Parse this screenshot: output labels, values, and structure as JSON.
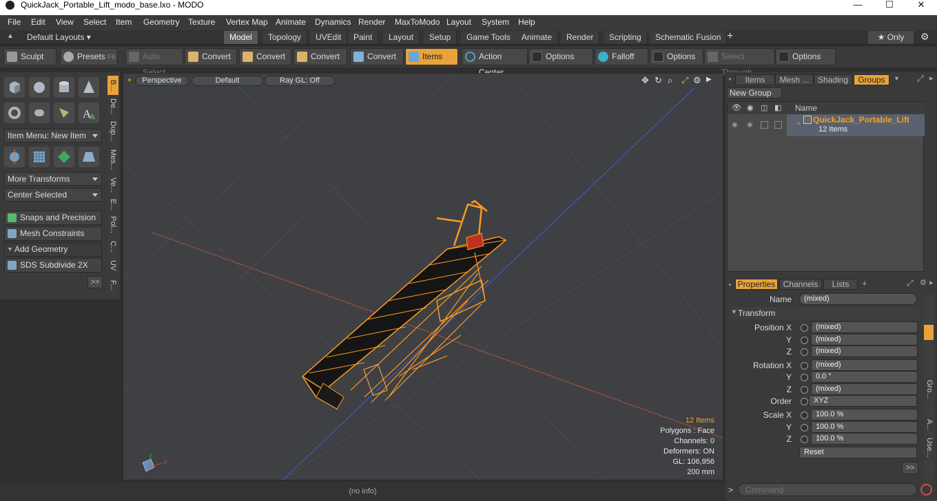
{
  "window": {
    "title": "QuickJack_Portable_Lift_modo_base.lxo - MODO",
    "minimize": "—",
    "maximize": "☐",
    "close": "✕"
  },
  "menu": [
    "File",
    "Edit",
    "View",
    "Select",
    "Item",
    "Geometry",
    "Texture",
    "Vertex Map",
    "Animate",
    "Dynamics",
    "Render",
    "MaxToModo",
    "Layout",
    "System",
    "Help"
  ],
  "layouts": {
    "selector": "Default Layouts ▾",
    "tabs": [
      "Model",
      "Topology",
      "UVEdit",
      "Paint",
      "Layout",
      "Setup",
      "Game Tools",
      "Animate",
      "Render",
      "Scripting",
      "Schematic Fusion"
    ],
    "add": "+",
    "only": "★ Only",
    "gear": "⚙"
  },
  "toolbar": {
    "sculpt": "Sculpt",
    "presets": "Presets",
    "presets_key": "F6",
    "auto_select": "Auto Select",
    "convert": "Convert",
    "items": "Items",
    "action_center": "Action Center",
    "options": "Options",
    "falloff": "Falloff",
    "select_through": "Select Through"
  },
  "left": {
    "item_menu": "Item Menu: New Item",
    "more_transforms": "More Transforms",
    "center_selected": "Center Selected",
    "snaps": "Snaps and Precision",
    "mesh_constraints": "Mesh Constraints",
    "add_geometry": "Add Geometry",
    "sds": "SDS Subdivide 2X",
    "expand": ">>",
    "vtabs": [
      "B...",
      "De...",
      "Dup...",
      "Mes...",
      "Ve...",
      "E...",
      "Pol...",
      "C...",
      "UV",
      "F..."
    ]
  },
  "viewport": {
    "perspective": "Perspective",
    "default": "Default",
    "raygl": "Ray GL: Off",
    "info": {
      "items": "12 Items",
      "polygons": "Polygons : Face",
      "channels": "Channels: 0",
      "deformers": "Deformers: ON",
      "gl": "GL: 106,956",
      "scale": "200 mm"
    }
  },
  "groups": {
    "tabs": [
      "Items",
      "Mesh ...",
      "Shading",
      "Groups"
    ],
    "new_group": "New Group",
    "col_name": "Name",
    "item_name": "QuickJack_Portable_Lift",
    "item_count": "12 Items"
  },
  "properties": {
    "tabs": [
      "Properties",
      "Channels",
      "Lists"
    ],
    "name_label": "Name",
    "name_value": "(mixed)",
    "transform": "Transform",
    "rows": [
      {
        "label": "Position X",
        "value": "(mixed)"
      },
      {
        "label": "Y",
        "value": "(mixed)"
      },
      {
        "label": "Z",
        "value": "(mixed)"
      },
      {
        "label": "Rotation X",
        "value": "(mixed)"
      },
      {
        "label": "Y",
        "value": "0.0 °"
      },
      {
        "label": "Z",
        "value": "(mixed)"
      },
      {
        "label": "Order",
        "value": "XYZ"
      },
      {
        "label": "Scale X",
        "value": "100.0 %"
      },
      {
        "label": "Y",
        "value": "100.0 %"
      },
      {
        "label": "Z",
        "value": "100.0 %"
      }
    ],
    "reset": "Reset",
    "expand": ">>",
    "side_tabs": [
      "Gro...",
      "A...",
      "Use..."
    ]
  },
  "status": {
    "info": "(no info)",
    "command_placeholder": "Command",
    "prompt": ">"
  },
  "colors": {
    "accent": "#e8a33a",
    "wire": "#ff9a1f",
    "viewport_bg": "#3e4044"
  }
}
